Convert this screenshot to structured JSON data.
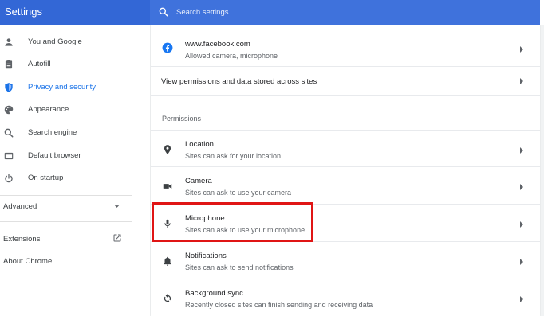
{
  "app": {
    "title": "Settings"
  },
  "search": {
    "placeholder": "Search settings"
  },
  "sidebar": {
    "items": [
      {
        "label": "You and Google",
        "icon": "person-icon"
      },
      {
        "label": "Autofill",
        "icon": "clipboard-icon"
      },
      {
        "label": "Privacy and security",
        "icon": "shield-icon",
        "active": true
      },
      {
        "label": "Appearance",
        "icon": "palette-icon"
      },
      {
        "label": "Search engine",
        "icon": "search-icon"
      },
      {
        "label": "Default browser",
        "icon": "browser-window-icon"
      },
      {
        "label": "On startup",
        "icon": "power-icon"
      }
    ],
    "advanced": "Advanced",
    "extensions": "Extensions",
    "about": "About Chrome"
  },
  "main": {
    "site_row": {
      "title": "www.facebook.com",
      "subtitle": "Allowed camera, microphone",
      "icon": "facebook-icon"
    },
    "view_permissions": "View permissions and data stored across sites",
    "permissions_heading": "Permissions",
    "permissions": [
      {
        "title": "Location",
        "subtitle": "Sites can ask for your location",
        "icon": "location-pin-icon"
      },
      {
        "title": "Camera",
        "subtitle": "Sites can ask to use your camera",
        "icon": "camera-icon"
      },
      {
        "title": "Microphone",
        "subtitle": "Sites can ask to use your microphone",
        "icon": "microphone-icon",
        "highlighted": true
      },
      {
        "title": "Notifications",
        "subtitle": "Sites can ask to send notifications",
        "icon": "bell-icon"
      },
      {
        "title": "Background sync",
        "subtitle": "Recently closed sites can finish sending and receiving data",
        "icon": "sync-icon"
      }
    ]
  },
  "colors": {
    "header_blue": "#3367d6",
    "search_blue": "#3f72dc",
    "active_blue": "#1a73e8",
    "highlight_red": "#e01515"
  }
}
